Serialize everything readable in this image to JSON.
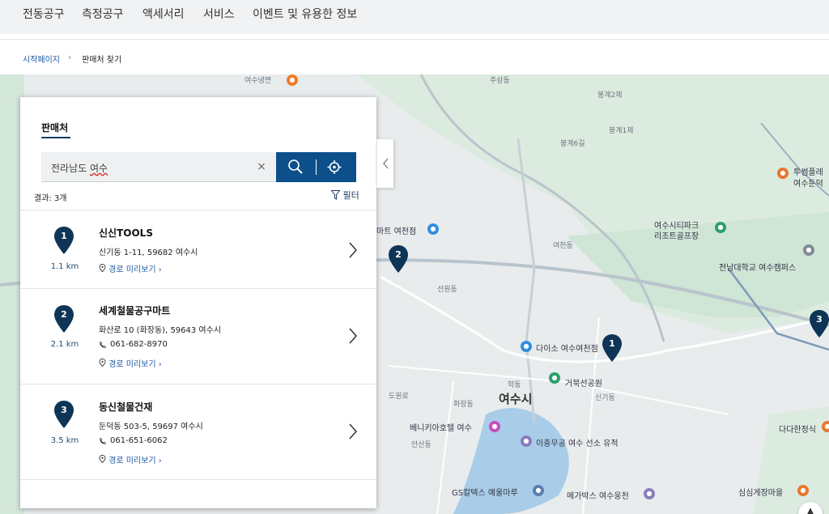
{
  "topnav": {
    "items": [
      "전동공구",
      "측정공구",
      "액세서리",
      "서비스",
      "이벤트 및 유용한 정보"
    ]
  },
  "breadcrumb": {
    "home": "시작페이지",
    "separator": "›",
    "current": "판매처 찾기"
  },
  "panel": {
    "tab_label": "판매처",
    "search_value_prefix": "전라남도 ",
    "search_value_word": "여수",
    "clear_label": "×",
    "results_count": "결과: 3개",
    "filter_label": "필터",
    "route_label": "경로 미리보기",
    "route_chevron": "›",
    "accent_color": "#0d4f8b",
    "results": [
      {
        "number": "1",
        "distance": "1.1 km",
        "name": "신신TOOLS",
        "address": "신기동 1-11, 59682 여수시",
        "phone": ""
      },
      {
        "number": "2",
        "distance": "2.1 km",
        "name": "세계철물공구마트",
        "address": "화산로 10 (화장동), 59643 여수시",
        "phone": "061-682-8970"
      },
      {
        "number": "3",
        "distance": "3.5 km",
        "name": "동신철물건재",
        "address": "둔덕동 503-5, 59697 여수시",
        "phone": "061-651-6062"
      }
    ]
  },
  "map": {
    "pins": [
      "1",
      "2",
      "3"
    ],
    "city_label": "여수시",
    "labels": {
      "yeosu_naengmyeon": "여수냉면",
      "bonggye2": "봉계2제",
      "bonggye1": "봉계1제",
      "bonggye6": "봉계6길",
      "jusamdong": "주삼동",
      "twosome": "투썸플레",
      "twosome2": "여수둔덕",
      "mart": "마트 여천점",
      "cityPark": "여수시티파크",
      "cityPark2": "리조트골프장",
      "chonnam": "전남대학교 여수캠퍼스",
      "yeocheondong": "여천동",
      "daiso": "다이소 여수여천점",
      "geobukseon": "거북선공원",
      "benikia": "베니키아호텔 여수",
      "admiral": "이충무공 여수 선소 유적",
      "gs": "GS칼텍스 예울마루",
      "megabox": "메가박스 여수웅천",
      "dadahan": "다다한정식",
      "simsim": "심심게장마을",
      "sinkidong": "신기동",
      "seonwondong": "선원동",
      "hakdong": "학동",
      "dowonro": "도원로",
      "hwajangdong": "화장동",
      "ansandong": "안산동"
    }
  },
  "scroll_top_label": "▲"
}
